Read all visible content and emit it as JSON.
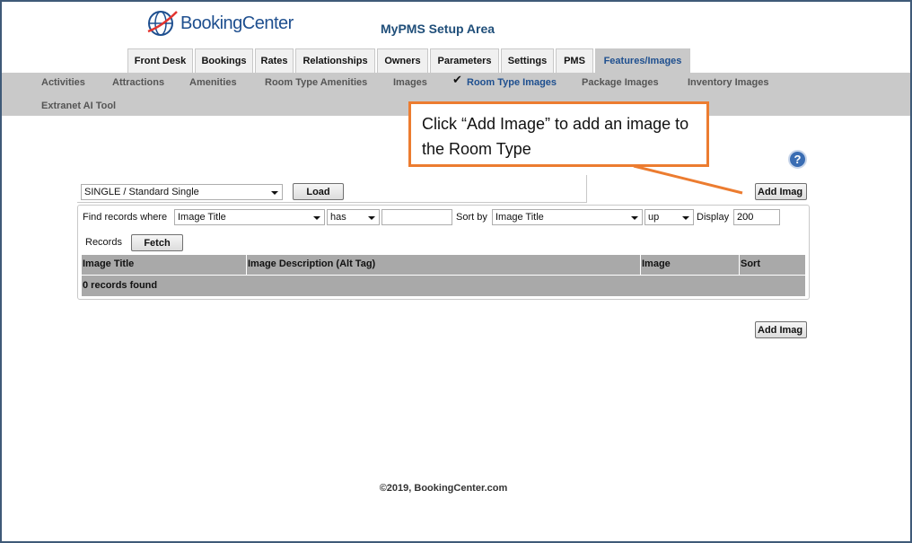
{
  "header": {
    "logo_text": "BookingCenter",
    "setup_title": "MyPMS Setup Area"
  },
  "tabs": [
    {
      "label": "Front Desk"
    },
    {
      "label": "Bookings"
    },
    {
      "label": "Rates"
    },
    {
      "label": "Relationships"
    },
    {
      "label": "Owners"
    },
    {
      "label": "Parameters"
    },
    {
      "label": "Settings"
    },
    {
      "label": "PMS"
    },
    {
      "label": "Features/Images"
    }
  ],
  "active_tab": "Features/Images",
  "subnav": [
    {
      "label": "Activities"
    },
    {
      "label": "Attractions"
    },
    {
      "label": "Amenities"
    },
    {
      "label": "Room Type Amenities"
    },
    {
      "label": "Images"
    },
    {
      "label": "Room Type Images"
    },
    {
      "label": "Package Images"
    },
    {
      "label": "Inventory Images"
    },
    {
      "label": "Extranet AI Tool"
    }
  ],
  "active_subnav": "Room Type Images",
  "callout": {
    "text": "Click “Add Image” to add an image to the Room Type"
  },
  "help_icon": {
    "glyph": "?"
  },
  "room_type_select": {
    "value": "SINGLE / Standard Single"
  },
  "load_button": "Load",
  "add_image_button": "Add Imag",
  "filter": {
    "find_label": "Find records where",
    "field_value": "Image Title",
    "op_value": "has",
    "search_value": "",
    "sort_label": "Sort by",
    "sort_value": "Image Title",
    "direction_value": "up",
    "display_label": "Display",
    "display_value": "200",
    "records_label": "Records",
    "fetch_button": "Fetch"
  },
  "grid": {
    "columns": [
      "Image Title",
      "Image Description (Alt Tag)",
      "Image",
      "Sort"
    ],
    "empty_message": "0 records found"
  },
  "footer": {
    "copyright": "©2019, BookingCenter.com"
  },
  "colors": {
    "accent": "#1e4f8f",
    "callout_border": "#ec7c30",
    "nav_bg": "#c9c9c9",
    "grid_header": "#a9a9a9"
  }
}
